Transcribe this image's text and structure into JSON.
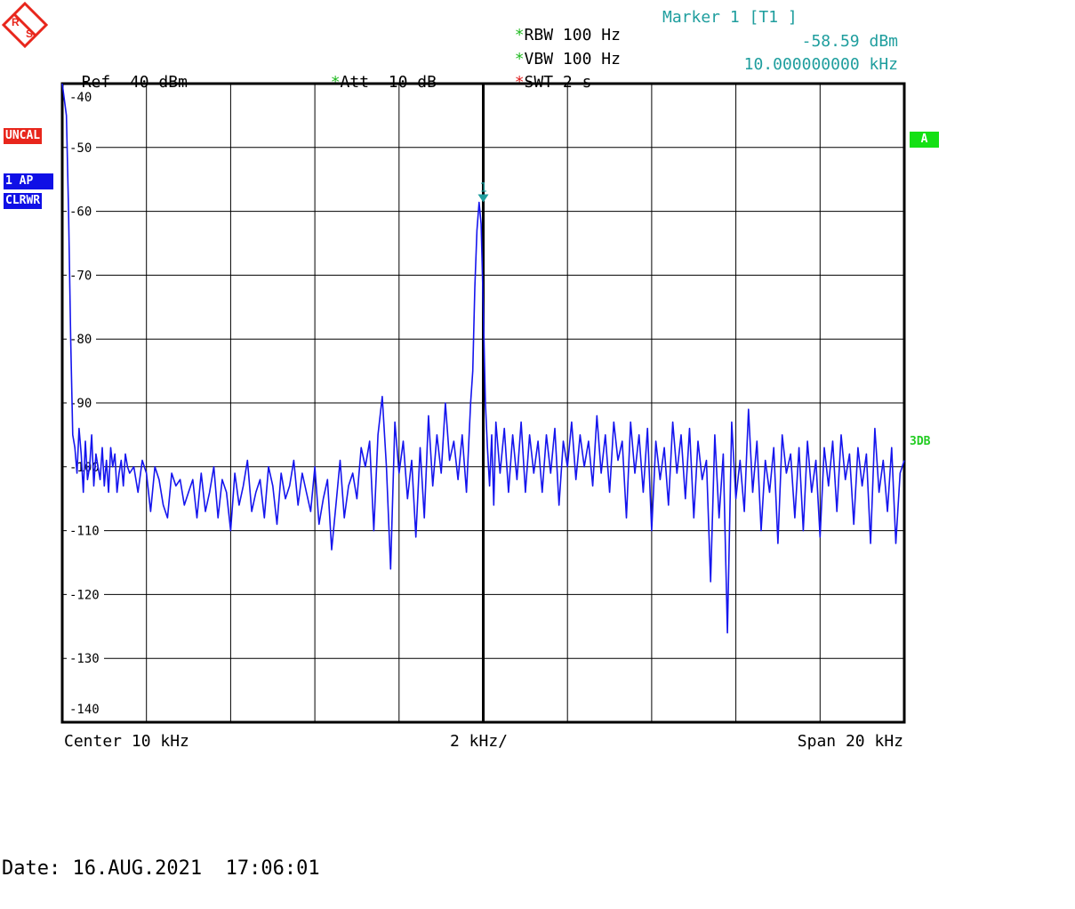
{
  "logo": {
    "letters": [
      "R",
      "S"
    ]
  },
  "header": {
    "ref_label": "Ref",
    "ref_value": "-40 dBm",
    "att_star": "*",
    "att_label": "Att",
    "att_value": "10 dB",
    "rbw_star": "*",
    "rbw_label": "RBW",
    "rbw_value": "100 Hz",
    "vbw_star": "*",
    "vbw_label": "VBW",
    "vbw_value": "100 Hz",
    "swt_star": "*",
    "swt_label": "SWT",
    "swt_value": "2 s",
    "marker_title": "Marker 1 [T1 ]",
    "marker_level": "-58.59 dBm",
    "marker_freq": "10.000000000 kHz"
  },
  "side_badges": {
    "uncal": "UNCAL",
    "trace_mode": "1 AP",
    "trace_type": "CLRWR",
    "window": "A",
    "threedb": "3DB"
  },
  "footer": {
    "center": "Center 10 kHz",
    "div": "2 kHz/",
    "span": "Span 20 kHz",
    "date": "Date: 16.AUG.2021  17:06:01"
  },
  "colors": {
    "trace": "#1515ee",
    "grid": "#000000",
    "marker": "#1f9e9e",
    "uncal_bg": "#e8261c",
    "trace_badge_bg": "#1010e6",
    "green_badge_bg": "#14e014",
    "star_green": "#22bb22",
    "star_red": "#e02020"
  },
  "chart_data": {
    "type": "line",
    "title": "",
    "xlabel": "",
    "ylabel": "",
    "xlim": [
      0,
      20
    ],
    "x_unit": "kHz",
    "ylim": [
      -140,
      -40
    ],
    "y_unit": "dBm",
    "yticks": [
      -40,
      -50,
      -60,
      -70,
      -80,
      -90,
      -100,
      -110,
      -120,
      -130,
      -140
    ],
    "ytick_labels": [
      "-40",
      "-50",
      "-60",
      "-70",
      "-80",
      "-90",
      "-100",
      "-110",
      "-120",
      "-130",
      "-140"
    ],
    "grid": true,
    "marker": {
      "label": "1",
      "x": 10.0,
      "y": -58.59
    },
    "series": [
      {
        "x": [
          0.0,
          0.1,
          0.15,
          0.2,
          0.25,
          0.3,
          0.35,
          0.4,
          0.45,
          0.5,
          0.55,
          0.6,
          0.65,
          0.7,
          0.75,
          0.8,
          0.85,
          0.9,
          0.95,
          1.0,
          1.05,
          1.1,
          1.15,
          1.2,
          1.25,
          1.3,
          1.35,
          1.4,
          1.45,
          1.5,
          1.55,
          1.6,
          1.7,
          1.8,
          1.9,
          2.0,
          2.1,
          2.2,
          2.3,
          2.4,
          2.5,
          2.6,
          2.7,
          2.8,
          2.9,
          3.0,
          3.1,
          3.2,
          3.3,
          3.4,
          3.5,
          3.6,
          3.7,
          3.8,
          3.9,
          4.0,
          4.1,
          4.2,
          4.3,
          4.4,
          4.5,
          4.6,
          4.7,
          4.8,
          4.9,
          5.0,
          5.1,
          5.2,
          5.3,
          5.4,
          5.5,
          5.6,
          5.7,
          5.8,
          5.9,
          6.0,
          6.1,
          6.2,
          6.3,
          6.4,
          6.5,
          6.6,
          6.7,
          6.8,
          6.9,
          7.0,
          7.1,
          7.2,
          7.3,
          7.4,
          7.5,
          7.6,
          7.7,
          7.8,
          7.9,
          8.0,
          8.1,
          8.2,
          8.3,
          8.4,
          8.5,
          8.6,
          8.7,
          8.8,
          8.9,
          9.0,
          9.1,
          9.2,
          9.3,
          9.4,
          9.5,
          9.6,
          9.7,
          9.75,
          9.8,
          9.85,
          9.9,
          9.95,
          10.0,
          10.05,
          10.1,
          10.15,
          10.2,
          10.25,
          10.3,
          10.4,
          10.5,
          10.6,
          10.7,
          10.8,
          10.9,
          11.0,
          11.1,
          11.2,
          11.3,
          11.4,
          11.5,
          11.6,
          11.7,
          11.8,
          11.9,
          12.0,
          12.1,
          12.2,
          12.3,
          12.4,
          12.5,
          12.6,
          12.7,
          12.8,
          12.9,
          13.0,
          13.1,
          13.2,
          13.3,
          13.4,
          13.5,
          13.6,
          13.7,
          13.8,
          13.9,
          14.0,
          14.1,
          14.2,
          14.3,
          14.4,
          14.5,
          14.6,
          14.7,
          14.8,
          14.9,
          15.0,
          15.1,
          15.2,
          15.3,
          15.4,
          15.5,
          15.6,
          15.7,
          15.8,
          15.9,
          16.0,
          16.1,
          16.2,
          16.3,
          16.4,
          16.5,
          16.6,
          16.7,
          16.8,
          16.9,
          17.0,
          17.1,
          17.2,
          17.3,
          17.4,
          17.5,
          17.6,
          17.7,
          17.8,
          17.9,
          18.0,
          18.1,
          18.2,
          18.3,
          18.4,
          18.5,
          18.6,
          18.7,
          18.8,
          18.9,
          19.0,
          19.1,
          19.2,
          19.3,
          19.4,
          19.5,
          19.6,
          19.7,
          19.8,
          19.9,
          20.0
        ],
        "y": [
          -40,
          -45,
          -60,
          -80,
          -95,
          -97,
          -101,
          -94,
          -98,
          -104,
          -96,
          -102,
          -100,
          -95,
          -103,
          -98,
          -100,
          -102,
          -97,
          -103,
          -99,
          -104,
          -97,
          -100,
          -98,
          -104,
          -101,
          -99,
          -103,
          -98,
          -100,
          -101,
          -100,
          -104,
          -99,
          -101,
          -107,
          -100,
          -102,
          -106,
          -108,
          -101,
          -103,
          -102,
          -106,
          -104,
          -102,
          -108,
          -101,
          -107,
          -104,
          -100,
          -108,
          -102,
          -104,
          -110,
          -101,
          -106,
          -103,
          -99,
          -107,
          -104,
          -102,
          -108,
          -100,
          -103,
          -109,
          -101,
          -105,
          -103,
          -99,
          -106,
          -101,
          -104,
          -107,
          -100,
          -109,
          -105,
          -102,
          -113,
          -106,
          -99,
          -108,
          -103,
          -101,
          -105,
          -97,
          -100,
          -96,
          -110,
          -95,
          -89,
          -100,
          -116,
          -93,
          -101,
          -96,
          -105,
          -99,
          -111,
          -97,
          -108,
          -92,
          -103,
          -95,
          -101,
          -90,
          -99,
          -96,
          -102,
          -95,
          -104,
          -90,
          -85,
          -72,
          -63,
          -58.6,
          -62,
          -75,
          -90,
          -97,
          -103,
          -95,
          -106,
          -93,
          -101,
          -94,
          -104,
          -95,
          -102,
          -93,
          -104,
          -95,
          -101,
          -96,
          -104,
          -95,
          -101,
          -94,
          -106,
          -96,
          -100,
          -93,
          -102,
          -95,
          -100,
          -96,
          -103,
          -92,
          -101,
          -95,
          -104,
          -93,
          -99,
          -96,
          -108,
          -93,
          -101,
          -95,
          -104,
          -94,
          -110,
          -96,
          -102,
          -97,
          -106,
          -93,
          -101,
          -95,
          -105,
          -94,
          -108,
          -96,
          -102,
          -99,
          -118,
          -95,
          -108,
          -98,
          -126,
          -93,
          -105,
          -99,
          -107,
          -91,
          -104,
          -96,
          -110,
          -99,
          -104,
          -97,
          -112,
          -95,
          -101,
          -98,
          -108,
          -97,
          -110,
          -96,
          -104,
          -99,
          -111,
          -97,
          -103,
          -96,
          -107,
          -95,
          -102,
          -98,
          -109,
          -97,
          -103,
          -98,
          -112,
          -94,
          -104,
          -99,
          -107,
          -97,
          -112,
          -101,
          -99
        ]
      }
    ]
  }
}
